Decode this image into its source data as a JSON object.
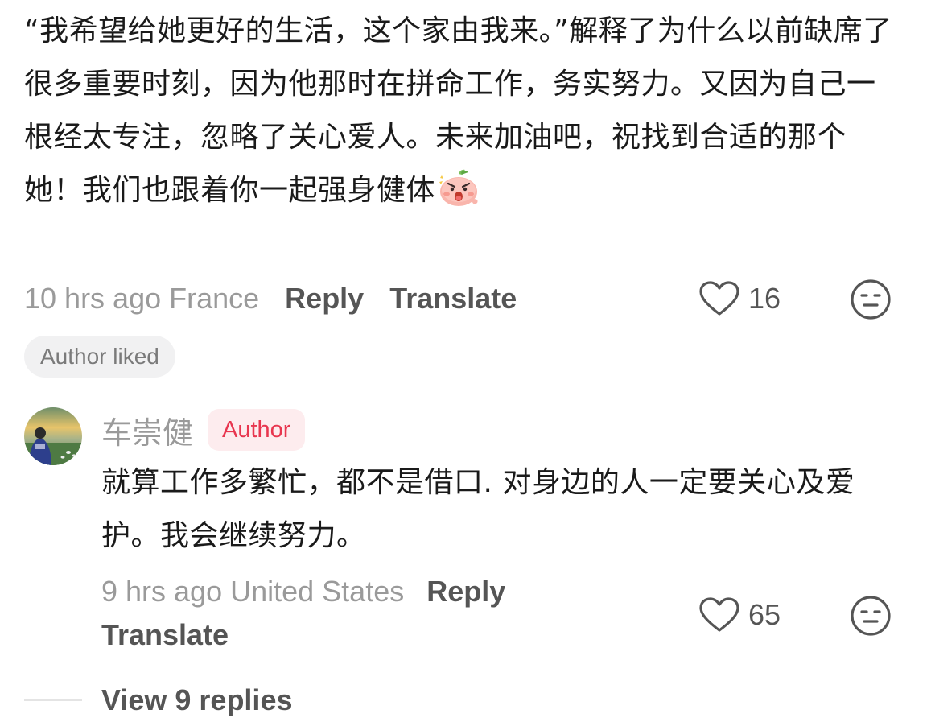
{
  "comment": {
    "text": "“我希望给她更好的生活，这个家由我来。”解释了为什么以前缺席了很多重要时刻，因为他那时在拼命工作，务实努力。又因为自己一根经太专注，忽略了关心爱人。未来加油吧，祝找到合适的那个她！我们也跟着你一起强身健体",
    "emoji_icon": "peach-shocked-emoji-icon",
    "time_location": "10 hrs ago France",
    "reply_label": "Reply",
    "translate_label": "Translate",
    "like_count": "16",
    "author_liked_label": "Author liked"
  },
  "reply": {
    "author_name": "车崇健",
    "author_badge": "Author",
    "text": "就算工作多繁忙，都不是借口. 对身边的人一定要关心及爱护。我会继续努力。",
    "time_location": "9 hrs ago United States",
    "reply_label": "Reply",
    "translate_label": "Translate",
    "like_count": "65"
  },
  "view_replies_label": "View 9 replies",
  "colors": {
    "text_primary": "#1a1a1a",
    "text_secondary": "#9a9a9a",
    "action": "#555555",
    "author_badge_bg": "#fdecee",
    "author_badge_fg": "#e8364f",
    "author_liked_bg": "#f1f1f2"
  }
}
